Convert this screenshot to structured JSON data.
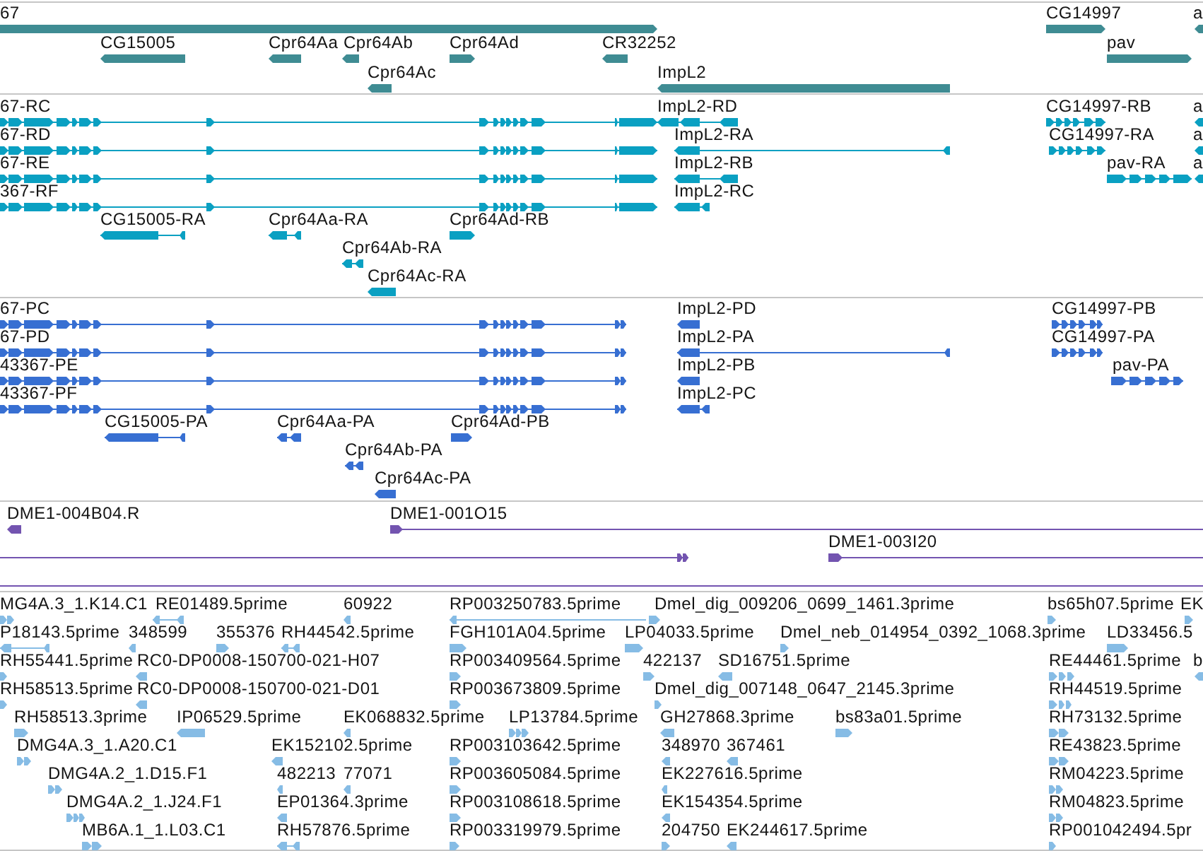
{
  "tracks": [
    {
      "kind": "gene",
      "features": [
        {
          "label": "67"
        },
        {
          "label": "CG14997"
        },
        {
          "label": "a"
        },
        {
          "label": "CG15005"
        },
        {
          "label": "Cpr64Aa"
        },
        {
          "label": "Cpr64Ab"
        },
        {
          "label": "Cpr64Ad"
        },
        {
          "label": "CR32252"
        },
        {
          "label": "pav"
        },
        {
          "label": "Cpr64Ac"
        },
        {
          "label": "ImpL2"
        }
      ]
    },
    {
      "kind": "mrna",
      "features": [
        {
          "label": "67-RC"
        },
        {
          "label": "ImpL2-RD"
        },
        {
          "label": "CG14997-RB"
        },
        {
          "label": "a"
        },
        {
          "label": "67-RD"
        },
        {
          "label": "ImpL2-RA"
        },
        {
          "label": "CG14997-RA"
        },
        {
          "label": "a"
        },
        {
          "label": "67-RE"
        },
        {
          "label": "ImpL2-RB"
        },
        {
          "label": "pav-RA"
        },
        {
          "label": "a"
        },
        {
          "label": "367-RF"
        },
        {
          "label": "ImpL2-RC"
        },
        {
          "label": "CG15005-RA"
        },
        {
          "label": "Cpr64Aa-RA"
        },
        {
          "label": "Cpr64Ad-RB"
        },
        {
          "label": "Cpr64Ab-RA"
        },
        {
          "label": "Cpr64Ac-RA"
        }
      ]
    },
    {
      "kind": "protein",
      "features": [
        {
          "label": "67-PC"
        },
        {
          "label": "ImpL2-PD"
        },
        {
          "label": "CG14997-PB"
        },
        {
          "label": "67-PD"
        },
        {
          "label": "ImpL2-PA"
        },
        {
          "label": "CG14997-PA"
        },
        {
          "label": "43367-PE"
        },
        {
          "label": "ImpL2-PB"
        },
        {
          "label": "pav-PA"
        },
        {
          "label": "43367-PF"
        },
        {
          "label": "ImpL2-PC"
        },
        {
          "label": "CG15005-PA"
        },
        {
          "label": "Cpr64Aa-PA"
        },
        {
          "label": "Cpr64Ad-PB"
        },
        {
          "label": "Cpr64Ab-PA"
        },
        {
          "label": "Cpr64Ac-PA"
        }
      ]
    },
    {
      "kind": "clone",
      "features": [
        {
          "label": "DME1-004B04.R"
        },
        {
          "label": "DME1-001O15"
        },
        {
          "label": "DME1-003I20"
        }
      ]
    },
    {
      "kind": "est",
      "features": [
        {
          "label": "MG4A.3_1.K14.C1"
        },
        {
          "label": "RE01489.5prime"
        },
        {
          "label": "60922"
        },
        {
          "label": "RP003250783.5prime"
        },
        {
          "label": "Dmel_dig_009206_0699_1461.3prime"
        },
        {
          "label": "bs65h07.5prime"
        },
        {
          "label": "EK"
        },
        {
          "label": "P18143.5prime"
        },
        {
          "label": "348599"
        },
        {
          "label": "355376"
        },
        {
          "label": "RH44542.5prime"
        },
        {
          "label": "FGH101A04.5prime"
        },
        {
          "label": "LP04033.5prime"
        },
        {
          "label": "Dmel_neb_014954_0392_1068.3prime"
        },
        {
          "label": "LD33456.5"
        },
        {
          "label": "RH55441.5prime"
        },
        {
          "label": "RC0-DP0008-150700-021-H07"
        },
        {
          "label": "RP003409564.5prime"
        },
        {
          "label": "422137"
        },
        {
          "label": "SD16751.5prime"
        },
        {
          "label": "RE44461.5prime"
        },
        {
          "label": "b"
        },
        {
          "label": "RH58513.5prime"
        },
        {
          "label": "RC0-DP0008-150700-021-D01"
        },
        {
          "label": "RP003673809.5prime"
        },
        {
          "label": "Dmel_dig_007148_0647_2145.3prime"
        },
        {
          "label": "RH44519.5prime"
        },
        {
          "label": "RH58513.3prime"
        },
        {
          "label": "IP06529.5prime"
        },
        {
          "label": "EK068832.5prime"
        },
        {
          "label": "LP13784.5prime"
        },
        {
          "label": "GH27868.3prime"
        },
        {
          "label": "bs83a01.5prime"
        },
        {
          "label": "RH73132.5prime"
        },
        {
          "label": "DMG4A.3_1.A20.C1"
        },
        {
          "label": "EK152102.5prime"
        },
        {
          "label": "RP003103642.5prime"
        },
        {
          "label": "348970"
        },
        {
          "label": "367461"
        },
        {
          "label": "RE43823.5prime"
        },
        {
          "label": "DMG4A.2_1.D15.F1"
        },
        {
          "label": "482213"
        },
        {
          "label": "77071"
        },
        {
          "label": "RP003605084.5prime"
        },
        {
          "label": "EK227616.5prime"
        },
        {
          "label": "RM04223.5prime"
        },
        {
          "label": "DMG4A.2_1.J24.F1"
        },
        {
          "label": "EP01364.3prime"
        },
        {
          "label": "RP003108618.5prime"
        },
        {
          "label": "EK154354.5prime"
        },
        {
          "label": "RM04823.5prime"
        },
        {
          "label": "MB6A.1_1.L03.C1"
        },
        {
          "label": "RH57876.5prime"
        },
        {
          "label": "RP003319979.5prime"
        },
        {
          "label": "204750"
        },
        {
          "label": "EK244617.5prime"
        },
        {
          "label": "RP001042494.5pr"
        }
      ]
    }
  ]
}
